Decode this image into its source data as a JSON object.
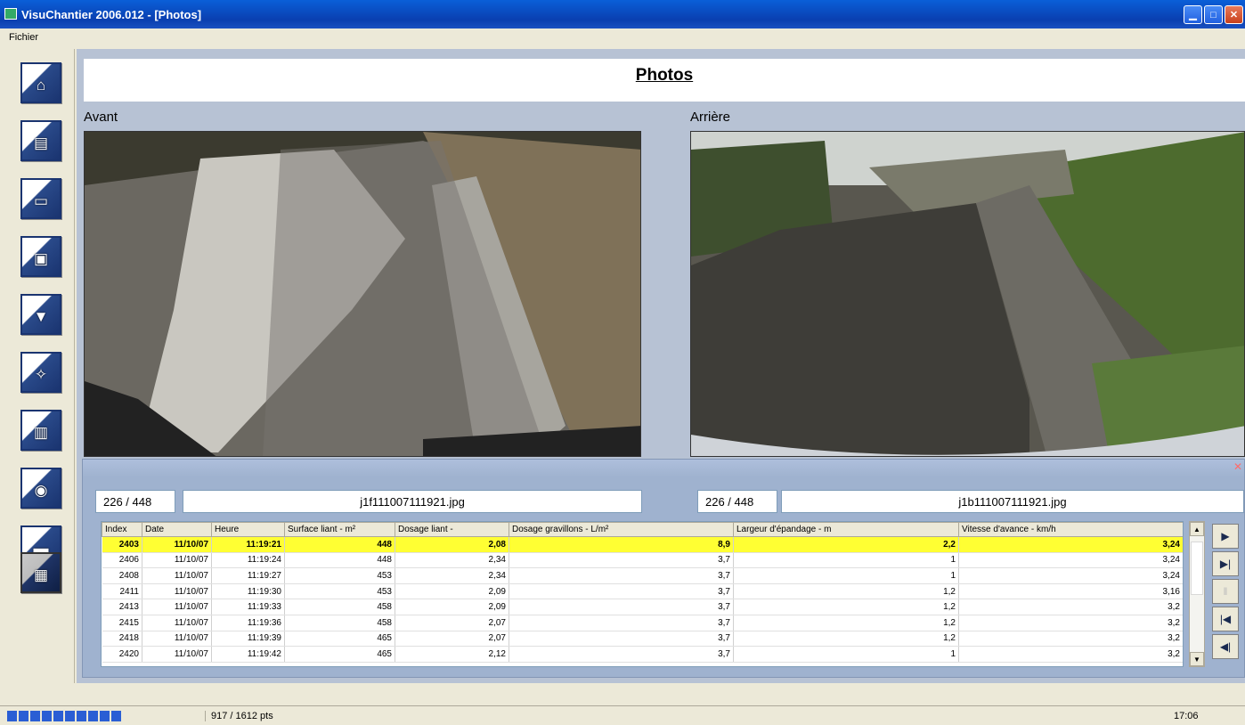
{
  "window": {
    "title": "VisuChantier 2006.012 - [Photos]"
  },
  "menu": {
    "fichier": "Fichier"
  },
  "nav_icons": [
    "home-icon",
    "chart-icon",
    "printer-icon",
    "monitor-icon",
    "pump-icon",
    "wrench-icon",
    "chart-stats-icon",
    "spray-icon",
    "truck-icon",
    "photo-icon"
  ],
  "page": {
    "title": "Photos"
  },
  "front": {
    "label": "Avant",
    "counter": "226 / 448",
    "filename": "j1f111007111921.jpg"
  },
  "rear": {
    "label": "Arrière",
    "counter": "226 / 448",
    "filename": "j1b111007111921.jpg"
  },
  "table": {
    "headers": [
      "Index",
      "Date",
      "Heure",
      "Surface liant - m²",
      "Dosage liant -",
      "Dosage gravillons - L/m²",
      "Largeur d'épandage - m",
      "Vitesse d'avance - km/h"
    ],
    "rows": [
      [
        "2403",
        "11/10/07",
        "11:19:21",
        "448",
        "2,08",
        "8,9",
        "2,2",
        "3,24"
      ],
      [
        "2406",
        "11/10/07",
        "11:19:24",
        "448",
        "2,34",
        "3,7",
        "1",
        "3,24"
      ],
      [
        "2408",
        "11/10/07",
        "11:19:27",
        "453",
        "2,34",
        "3,7",
        "1",
        "3,24"
      ],
      [
        "2411",
        "11/10/07",
        "11:19:30",
        "453",
        "2,09",
        "3,7",
        "1,2",
        "3,16"
      ],
      [
        "2413",
        "11/10/07",
        "11:19:33",
        "458",
        "2,09",
        "3,7",
        "1,2",
        "3,2"
      ],
      [
        "2415",
        "11/10/07",
        "11:19:36",
        "458",
        "2,07",
        "3,7",
        "1,2",
        "3,2"
      ],
      [
        "2418",
        "11/10/07",
        "11:19:39",
        "465",
        "2,07",
        "3,7",
        "1,2",
        "3,2"
      ],
      [
        "2420",
        "11/10/07",
        "11:19:42",
        "465",
        "2,12",
        "3,7",
        "1",
        "3,2"
      ]
    ],
    "selected_index": 0
  },
  "nav_buttons": {
    "play": "▶",
    "next": "▶|",
    "pause": "‖",
    "first": "|◀",
    "prev": "◀|"
  },
  "status": {
    "points": "917 / 1612 pts",
    "time": "17:06"
  }
}
